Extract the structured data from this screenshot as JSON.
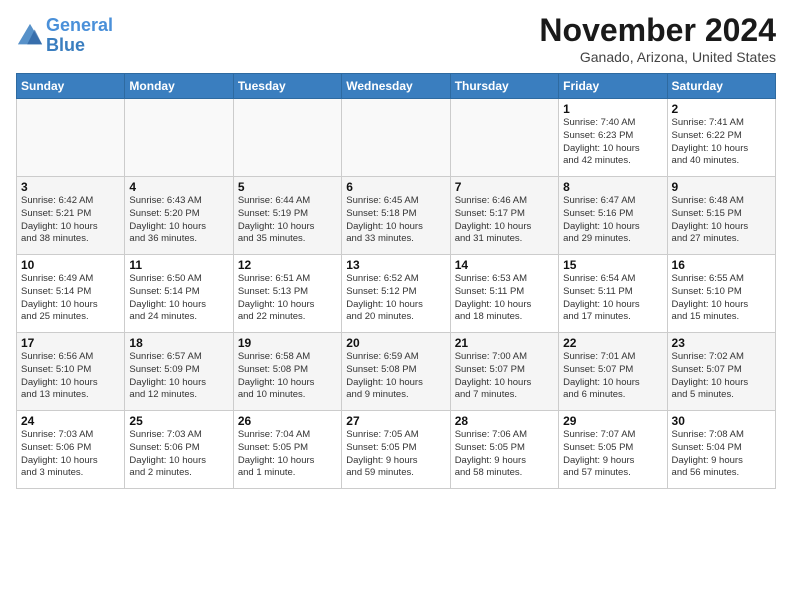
{
  "header": {
    "logo_line1": "General",
    "logo_line2": "Blue",
    "month_title": "November 2024",
    "subtitle": "Ganado, Arizona, United States"
  },
  "days_of_week": [
    "Sunday",
    "Monday",
    "Tuesday",
    "Wednesday",
    "Thursday",
    "Friday",
    "Saturday"
  ],
  "weeks": [
    [
      {
        "day": "",
        "info": ""
      },
      {
        "day": "",
        "info": ""
      },
      {
        "day": "",
        "info": ""
      },
      {
        "day": "",
        "info": ""
      },
      {
        "day": "",
        "info": ""
      },
      {
        "day": "1",
        "info": "Sunrise: 7:40 AM\nSunset: 6:23 PM\nDaylight: 10 hours\nand 42 minutes."
      },
      {
        "day": "2",
        "info": "Sunrise: 7:41 AM\nSunset: 6:22 PM\nDaylight: 10 hours\nand 40 minutes."
      }
    ],
    [
      {
        "day": "3",
        "info": "Sunrise: 6:42 AM\nSunset: 5:21 PM\nDaylight: 10 hours\nand 38 minutes."
      },
      {
        "day": "4",
        "info": "Sunrise: 6:43 AM\nSunset: 5:20 PM\nDaylight: 10 hours\nand 36 minutes."
      },
      {
        "day": "5",
        "info": "Sunrise: 6:44 AM\nSunset: 5:19 PM\nDaylight: 10 hours\nand 35 minutes."
      },
      {
        "day": "6",
        "info": "Sunrise: 6:45 AM\nSunset: 5:18 PM\nDaylight: 10 hours\nand 33 minutes."
      },
      {
        "day": "7",
        "info": "Sunrise: 6:46 AM\nSunset: 5:17 PM\nDaylight: 10 hours\nand 31 minutes."
      },
      {
        "day": "8",
        "info": "Sunrise: 6:47 AM\nSunset: 5:16 PM\nDaylight: 10 hours\nand 29 minutes."
      },
      {
        "day": "9",
        "info": "Sunrise: 6:48 AM\nSunset: 5:15 PM\nDaylight: 10 hours\nand 27 minutes."
      }
    ],
    [
      {
        "day": "10",
        "info": "Sunrise: 6:49 AM\nSunset: 5:14 PM\nDaylight: 10 hours\nand 25 minutes."
      },
      {
        "day": "11",
        "info": "Sunrise: 6:50 AM\nSunset: 5:14 PM\nDaylight: 10 hours\nand 24 minutes."
      },
      {
        "day": "12",
        "info": "Sunrise: 6:51 AM\nSunset: 5:13 PM\nDaylight: 10 hours\nand 22 minutes."
      },
      {
        "day": "13",
        "info": "Sunrise: 6:52 AM\nSunset: 5:12 PM\nDaylight: 10 hours\nand 20 minutes."
      },
      {
        "day": "14",
        "info": "Sunrise: 6:53 AM\nSunset: 5:11 PM\nDaylight: 10 hours\nand 18 minutes."
      },
      {
        "day": "15",
        "info": "Sunrise: 6:54 AM\nSunset: 5:11 PM\nDaylight: 10 hours\nand 17 minutes."
      },
      {
        "day": "16",
        "info": "Sunrise: 6:55 AM\nSunset: 5:10 PM\nDaylight: 10 hours\nand 15 minutes."
      }
    ],
    [
      {
        "day": "17",
        "info": "Sunrise: 6:56 AM\nSunset: 5:10 PM\nDaylight: 10 hours\nand 13 minutes."
      },
      {
        "day": "18",
        "info": "Sunrise: 6:57 AM\nSunset: 5:09 PM\nDaylight: 10 hours\nand 12 minutes."
      },
      {
        "day": "19",
        "info": "Sunrise: 6:58 AM\nSunset: 5:08 PM\nDaylight: 10 hours\nand 10 minutes."
      },
      {
        "day": "20",
        "info": "Sunrise: 6:59 AM\nSunset: 5:08 PM\nDaylight: 10 hours\nand 9 minutes."
      },
      {
        "day": "21",
        "info": "Sunrise: 7:00 AM\nSunset: 5:07 PM\nDaylight: 10 hours\nand 7 minutes."
      },
      {
        "day": "22",
        "info": "Sunrise: 7:01 AM\nSunset: 5:07 PM\nDaylight: 10 hours\nand 6 minutes."
      },
      {
        "day": "23",
        "info": "Sunrise: 7:02 AM\nSunset: 5:07 PM\nDaylight: 10 hours\nand 5 minutes."
      }
    ],
    [
      {
        "day": "24",
        "info": "Sunrise: 7:03 AM\nSunset: 5:06 PM\nDaylight: 10 hours\nand 3 minutes."
      },
      {
        "day": "25",
        "info": "Sunrise: 7:03 AM\nSunset: 5:06 PM\nDaylight: 10 hours\nand 2 minutes."
      },
      {
        "day": "26",
        "info": "Sunrise: 7:04 AM\nSunset: 5:05 PM\nDaylight: 10 hours\nand 1 minute."
      },
      {
        "day": "27",
        "info": "Sunrise: 7:05 AM\nSunset: 5:05 PM\nDaylight: 9 hours\nand 59 minutes."
      },
      {
        "day": "28",
        "info": "Sunrise: 7:06 AM\nSunset: 5:05 PM\nDaylight: 9 hours\nand 58 minutes."
      },
      {
        "day": "29",
        "info": "Sunrise: 7:07 AM\nSunset: 5:05 PM\nDaylight: 9 hours\nand 57 minutes."
      },
      {
        "day": "30",
        "info": "Sunrise: 7:08 AM\nSunset: 5:04 PM\nDaylight: 9 hours\nand 56 minutes."
      }
    ]
  ]
}
